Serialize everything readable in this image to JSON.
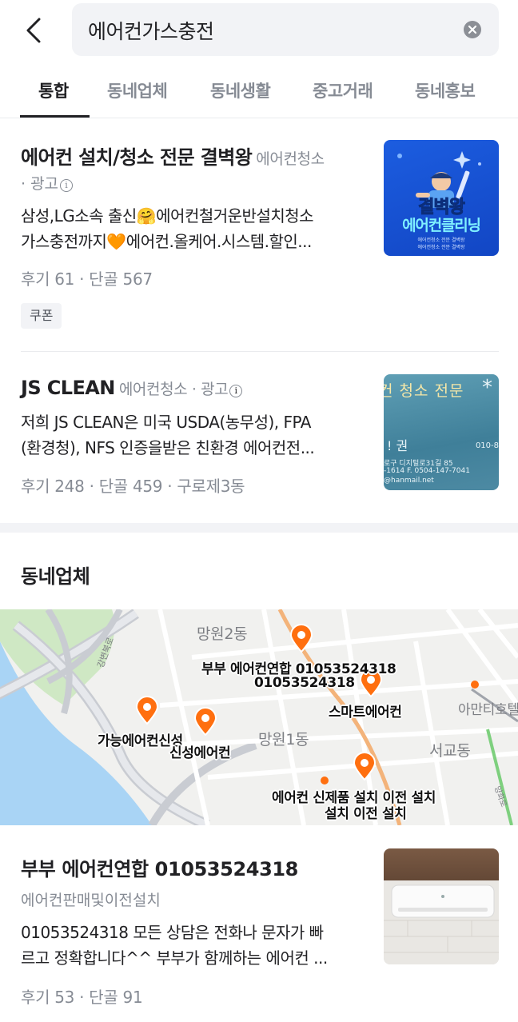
{
  "search": {
    "query": "에어컨가스충전"
  },
  "tabs": [
    {
      "label": "통합",
      "active": true
    },
    {
      "label": "동네업체"
    },
    {
      "label": "동네생활"
    },
    {
      "label": "중고거래"
    },
    {
      "label": "동네홍보"
    }
  ],
  "ads": [
    {
      "title": "에어컨 설치/청소 전문 결벽왕",
      "category": "에어컨청소",
      "ad_label": "· 광고",
      "desc_line1": "삼성,LG소속 출신🤗에어컨철거운반설치청소",
      "desc_line2": "가스충전까지🧡에어컨.올케어.시스템.할인...",
      "meta": "후기 61 · 단골 567",
      "coupon": "쿠폰",
      "thumb": {
        "line1": "결벽왕",
        "line2": "에어컨클리닝",
        "small1": "에어컨청소 전문 결벽왕",
        "small2": "에어컨청소 전문 결벽왕"
      }
    },
    {
      "title": "JS CLEAN",
      "category": "에어컨청소 · 광고",
      "desc_line1": "저희 JS CLEAN은 미국 USDA(농무성), FPA",
      "desc_line2": "(환경청), NFS 인증을받은 친환경 에어컨전...",
      "meta": "후기 248 · 단골 459 · 구로제3동",
      "thumb": {
        "top": "컨 청소 전문",
        "mid": "! 권",
        "num": "010-8",
        "addr1": "로구 디지털로31길 85",
        "addr2": "-1614 F. 0504-147-7041",
        "addr3": "@hanmail.net"
      }
    }
  ],
  "section": {
    "title": "동네업체"
  },
  "map": {
    "area_labels": [
      "망원2동",
      "망원1동",
      "서교동",
      "아만티호텔",
      "양화로"
    ],
    "road_label": "강변북로",
    "pins": [
      {
        "label": "부부 에어컨연합 01053524318"
      },
      {
        "label": "01053524318"
      },
      {
        "label": "스마트에어컨"
      },
      {
        "label": "가능에어컨신성"
      },
      {
        "label": "신성에어컨"
      },
      {
        "label": "에어컨 신제품 설치 이전 설치"
      },
      {
        "label": "설치 이전 설치"
      }
    ],
    "pin_color": "#ff6f0f"
  },
  "listing": {
    "title": "부부 에어컨연합 01053524318",
    "category": "에어컨판매및이전설치",
    "desc_line1": "01053524318 모든 상담은 전화나 문자가 빠",
    "desc_line2": "르고 정확합니다^^ 부부가 함께하는 에어컨 ...",
    "meta": "후기 53 · 단골 91"
  }
}
